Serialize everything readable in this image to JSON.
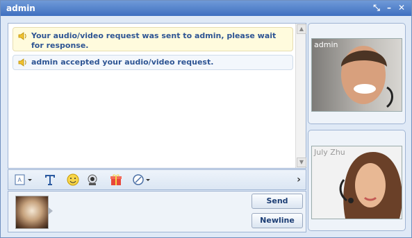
{
  "window": {
    "title": "admin"
  },
  "title_buttons": {
    "restore": "⤡",
    "minimize": "–",
    "close": "✕"
  },
  "messages": [
    {
      "text": "Your audio/video request was sent to admin, please wait for response."
    },
    {
      "text": "admin accepted your audio/video request."
    }
  ],
  "toolbar": {
    "items": [
      "font-style-menu",
      "text-format",
      "emoticon",
      "webcam",
      "gift",
      "screenshot-menu",
      "expand"
    ]
  },
  "buttons": {
    "send": "Send",
    "newline": "Newline"
  },
  "video": {
    "remote_name": "admin",
    "local_name": "July Zhu"
  },
  "colors": {
    "title_start": "#6f9ad8",
    "title_end": "#3f6fc0",
    "message_text": "#2d5493"
  }
}
